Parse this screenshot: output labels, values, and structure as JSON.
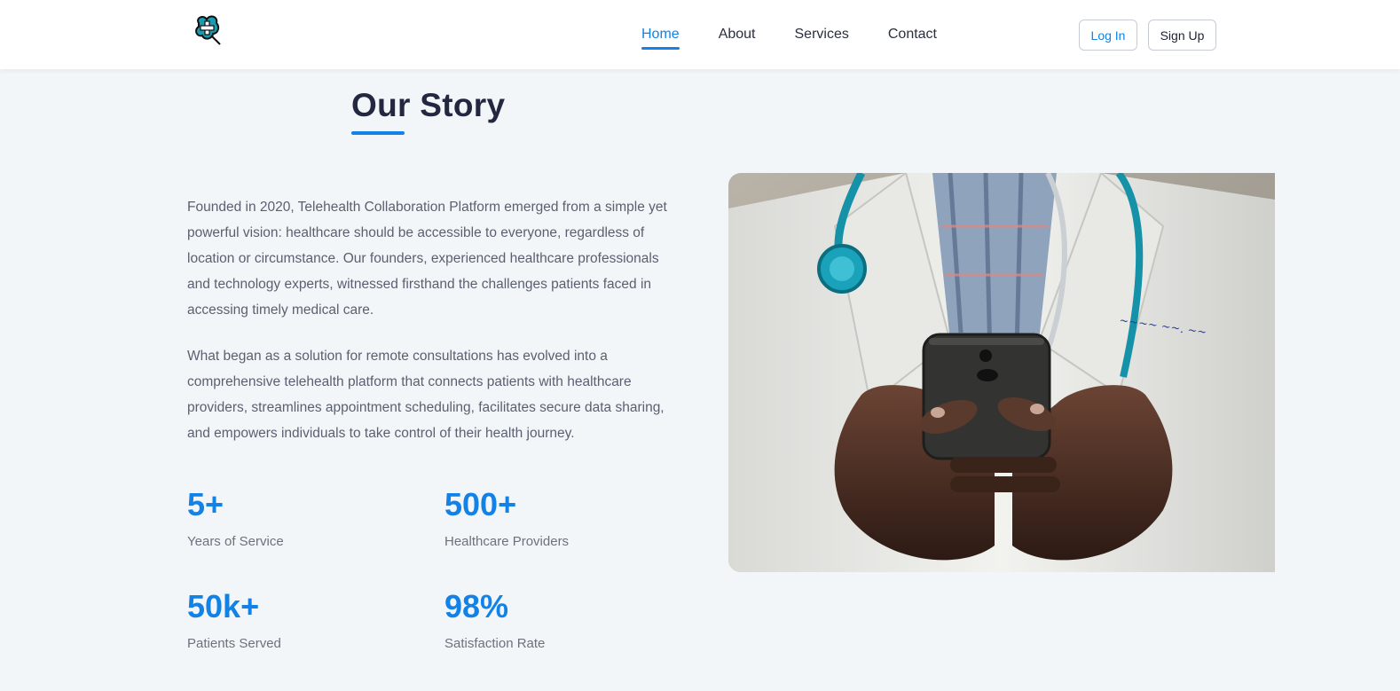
{
  "nav": {
    "logo_icon": "medical-cross-logo-icon",
    "links": [
      {
        "label": "Home",
        "active": true
      },
      {
        "label": "About",
        "active": false
      },
      {
        "label": "Services",
        "active": false
      },
      {
        "label": "Contact",
        "active": false
      }
    ],
    "login_label": "Log In",
    "signup_label": "Sign Up"
  },
  "story": {
    "title": "Our Story",
    "paragraphs": [
      "Founded in 2020, Telehealth Collaboration Platform emerged from a simple yet powerful vision: healthcare should be accessible to everyone, regardless of location or circumstance. Our founders, experienced healthcare professionals and technology experts, witnessed firsthand the challenges patients faced in accessing timely medical care.",
      "What began as a solution for remote consultations has evolved into a comprehensive telehealth platform that connects patients with healthcare providers, streamlines appointment scheduling, facilitates secure data sharing, and empowers individuals to take control of their health journey."
    ],
    "stats": [
      {
        "value": "5+",
        "label": "Years of Service"
      },
      {
        "value": "500+",
        "label": "Healthcare Providers"
      },
      {
        "value": "50k+",
        "label": "Patients Served"
      },
      {
        "value": "98%",
        "label": "Satisfaction Rate"
      }
    ]
  },
  "colors": {
    "accent": "#1282e6",
    "heading": "#232840",
    "body_text": "#5a6070",
    "background": "#f3f6f9"
  }
}
